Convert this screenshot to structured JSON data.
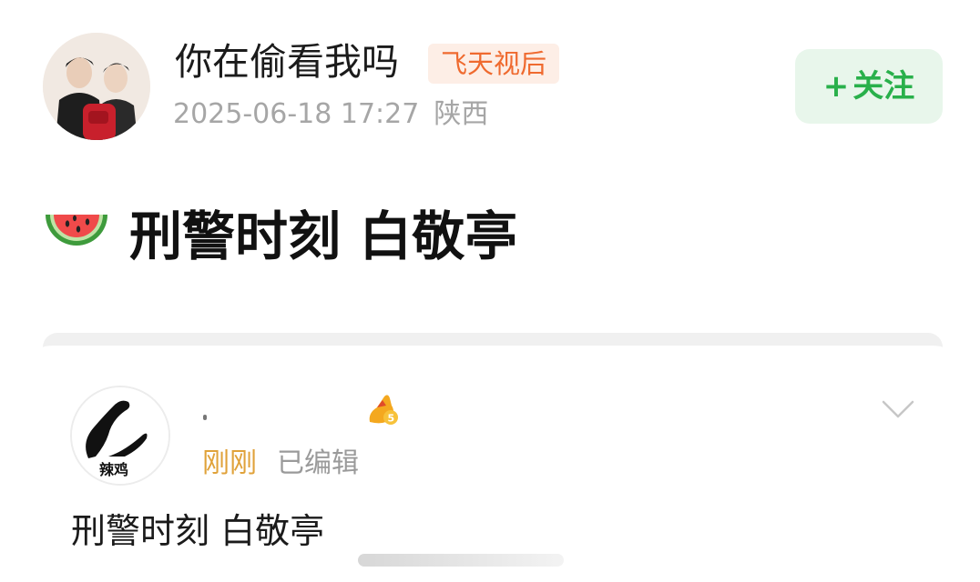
{
  "post": {
    "username": "你在偷看我吗",
    "badge": "飞天视后",
    "timestamp": "2025-06-18 17:27",
    "location": "陕西",
    "follow_plus": "+",
    "follow_label": "关注",
    "emoji_icon": "watermelon-icon",
    "text": "刑警时刻 白敬亭"
  },
  "quoted": {
    "avatar_label": "辣鸡",
    "level_icon": "level-5-badge-icon",
    "time": "刚刚",
    "edited": "已编辑",
    "text": "刑警时刻 白敬亭"
  },
  "colors": {
    "follow_green": "#29b04b",
    "badge_orange": "#ef6a2f",
    "time_gold": "#e0a23a"
  }
}
